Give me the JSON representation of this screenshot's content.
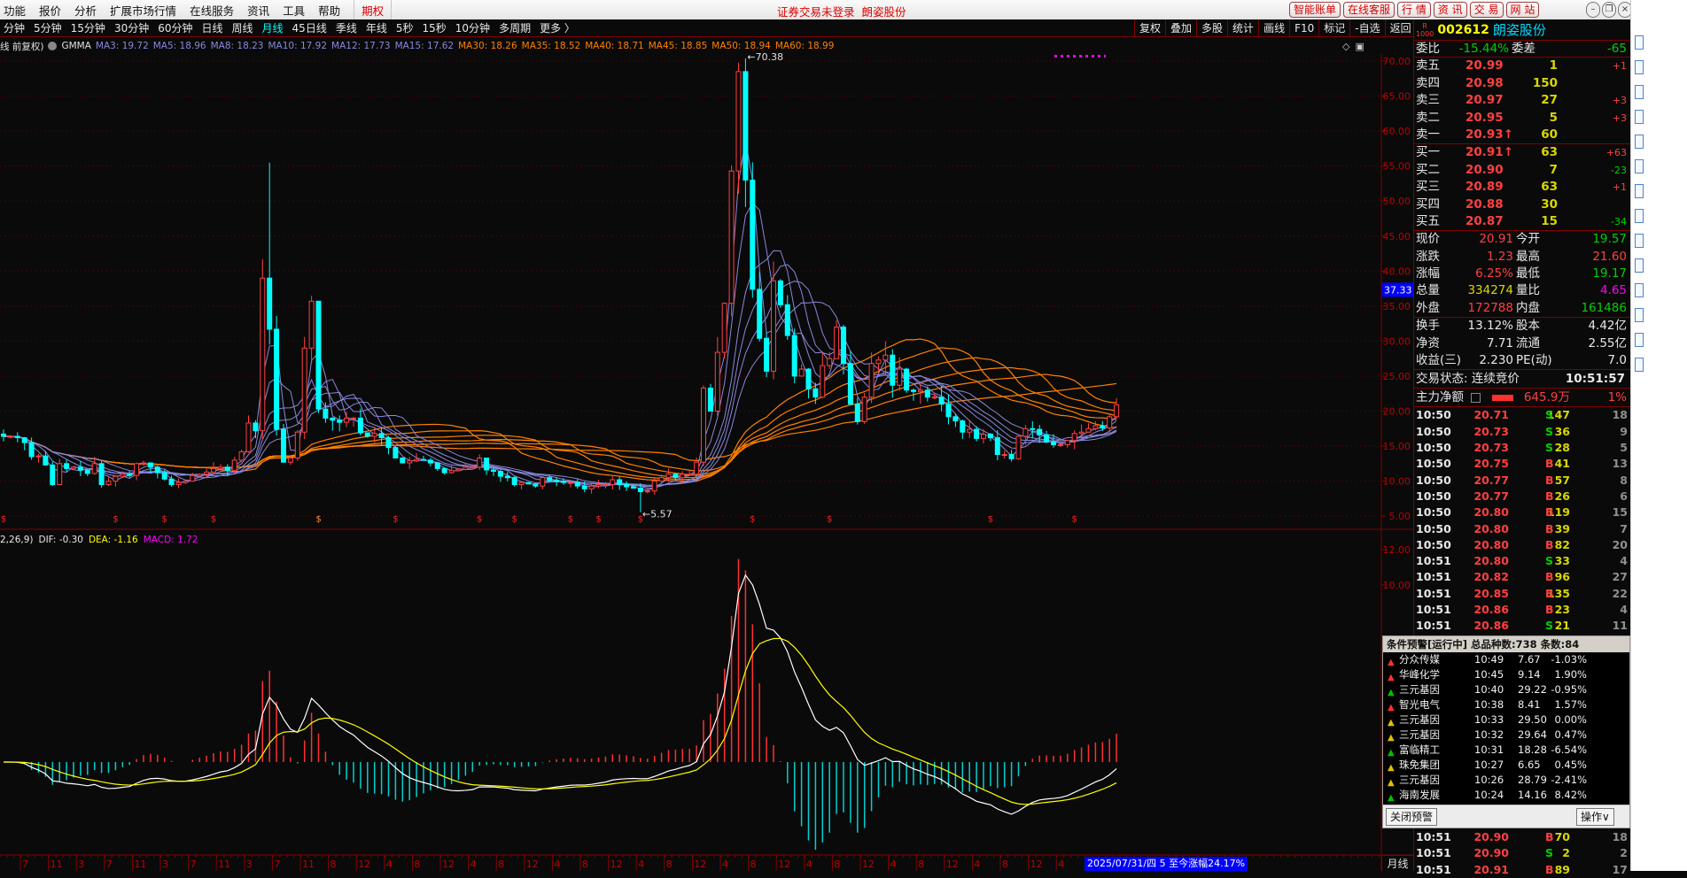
{
  "menu": [
    "功能",
    "报价",
    "分析",
    "扩展市场行情",
    "在线服务",
    "资讯",
    "工具",
    "帮助"
  ],
  "menu_option": "期权",
  "login_status": "证券交易未登录",
  "window_stock": "朗姿股份",
  "top_buttons": [
    "智能账单",
    "在线客服",
    "行 情",
    "资 讯",
    "交 易",
    "网 站"
  ],
  "window_buttons": [
    "–",
    "❐",
    "×"
  ],
  "periods": [
    "分钟",
    "5分钟",
    "15分钟",
    "30分钟",
    "60分钟",
    "日线",
    "周线",
    "月线",
    "45日线",
    "季线",
    "年线",
    "5秒",
    "15秒",
    "10分钟",
    "多周期",
    "更多 〉"
  ],
  "active_period": "月线",
  "tools": [
    "复权",
    "叠加",
    "多股",
    "统计",
    "画线",
    "F10",
    "标记",
    "-自选",
    "返回"
  ],
  "ma_legend": {
    "prefix": "线 前复权)",
    "name": "GMMA",
    "short": [
      "MA3: 19.72",
      "MA5: 18.96",
      "MA8: 18.23",
      "MA10: 17.92",
      "MA12: 17.73",
      "MA15: 17.62"
    ],
    "long": [
      "MA30: 18.26",
      "MA35: 18.52",
      "MA40: 18.71",
      "MA45: 18.85",
      "MA50: 18.94",
      "MA60: 18.99"
    ]
  },
  "macd_legend": {
    "params": "2,26,9)",
    "dif": "DIF: -0.30",
    "dea": "DEA: -1.16",
    "macd": "MACD: 1.72"
  },
  "colors": {
    "up": "#ff4040",
    "down": "#00ffff",
    "ma_short": "#8888dd",
    "ma_long": "#ff8000",
    "dif": "#ffffff",
    "dea": "#ffff00"
  },
  "chart_data": {
    "type": "candlestick",
    "period": "月线",
    "closes": [
      16.4,
      16.4,
      16.2,
      15.5,
      13.5,
      13.6,
      12.3,
      9.5,
      12.5,
      11.8,
      12,
      11.6,
      11.1,
      12.5,
      9.5,
      10,
      10.7,
      11,
      10.8,
      12.5,
      12.6,
      12,
      11.2,
      10.3,
      9.5,
      9.8,
      10,
      10.8,
      11,
      11.3,
      11.8,
      12,
      11.5,
      13,
      14.2,
      18.3,
      17.2,
      39,
      31.7,
      17.4,
      12.7,
      13.3,
      17,
      29,
      35.7,
      20.3,
      19,
      18.7,
      18.4,
      19,
      19,
      16.9,
      16.4,
      16.8,
      16.2,
      14.8,
      13.3,
      12.6,
      12.9,
      13.1,
      13,
      12.6,
      11.8,
      11.2,
      11.5,
      11.7,
      12,
      12,
      13.3,
      11.6,
      11.4,
      10.7,
      10.5,
      9.5,
      9.8,
      9.6,
      9.3,
      10.5,
      10.1,
      10,
      9.8,
      9.8,
      9.3,
      8.9,
      9.3,
      9.5,
      9.5,
      10.2,
      9.5,
      9.2,
      9,
      8.5,
      8.6,
      10,
      10.5,
      11,
      10.5,
      11,
      11,
      12.7,
      23.3,
      20,
      28.4,
      35.4,
      54.3,
      68.5,
      53,
      37.4,
      30.4,
      25.7,
      38.6,
      35.2,
      30.8,
      25,
      26,
      23.2,
      22,
      26.5,
      27.5,
      32,
      26.8,
      21,
      18.5,
      22,
      26.8,
      27.3,
      28,
      23.7,
      26,
      23,
      22.8,
      23,
      22,
      22,
      21,
      19.2,
      18.6,
      17,
      17.4,
      16.1,
      16.7,
      16.2,
      13.8,
      13.8,
      13.2,
      16.4,
      17.5,
      17.4,
      16.6,
      15.6,
      15.2,
      15.2,
      15.8,
      16.8,
      17,
      17.5,
      17.9,
      17.6,
      19.2,
      20.91
    ],
    "extremes": [
      {
        "index": 38,
        "high": 55.5
      },
      {
        "index": 106,
        "high": 70.38,
        "label": "70.38"
      },
      {
        "index": 91,
        "low": 5.57,
        "label": "5.57"
      }
    ],
    "price_axis": [
      "70.00",
      "65.00",
      "60.00",
      "55.00",
      "50.00",
      "45.00",
      "40.00",
      "35.00",
      "30.00",
      "25.00",
      "20.00",
      "15.00",
      "10.00",
      "5.00"
    ],
    "price_axis_values": [
      70,
      65,
      60,
      55,
      50,
      45,
      40,
      35,
      30,
      25,
      20,
      15,
      10,
      5
    ],
    "cursor_price": "37.33",
    "macd_axis": [
      "12.00",
      "10.00"
    ],
    "macd_axis_values": [
      12,
      10
    ],
    "signal_marks": [
      0,
      16,
      23,
      30,
      45,
      56,
      68,
      73,
      81,
      85,
      91,
      107,
      118,
      141,
      153
    ],
    "x_labels": [
      "7",
      "11",
      "3",
      "7",
      "11",
      "3",
      "7",
      "11",
      "3",
      "7",
      "11",
      "8",
      "12",
      "4",
      "8",
      "12",
      "4",
      "8",
      "12",
      "4",
      "8",
      "12",
      "4",
      "8",
      "12",
      "4",
      "8",
      "12",
      "4",
      "8",
      "12",
      "4",
      "8",
      "12",
      "4",
      "8",
      "12",
      "4"
    ]
  },
  "status_box": "2025/07/31/四 5 至今涨幅24.17%",
  "period_label": "月线",
  "panel": {
    "badge_top": "R",
    "badge_bottom": "1000",
    "code": "002612",
    "name": "朗姿股份",
    "weibi_label": "委比",
    "weibi": "-15.44%",
    "weicha_label": "委差",
    "weicha": "-65",
    "sells": [
      {
        "label": "卖五",
        "price": "20.99",
        "vol": "1",
        "chg": "+1"
      },
      {
        "label": "卖四",
        "price": "20.98",
        "vol": "150",
        "chg": ""
      },
      {
        "label": "卖三",
        "price": "20.97",
        "vol": "27",
        "chg": "+3"
      },
      {
        "label": "卖二",
        "price": "20.95",
        "vol": "5",
        "chg": "+3"
      },
      {
        "label": "卖一",
        "price": "20.93↑",
        "vol": "60",
        "chg": ""
      }
    ],
    "buys": [
      {
        "label": "买一",
        "price": "20.91↑",
        "vol": "63",
        "chg": "+63"
      },
      {
        "label": "买二",
        "price": "20.90",
        "vol": "7",
        "chg": "-23"
      },
      {
        "label": "买三",
        "price": "20.89",
        "vol": "63",
        "chg": "+1"
      },
      {
        "label": "买四",
        "price": "20.88",
        "vol": "30",
        "chg": ""
      },
      {
        "label": "买五",
        "price": "20.87",
        "vol": "15",
        "chg": "-34"
      }
    ],
    "quote": [
      {
        "l1": "现价",
        "v1": "20.91",
        "l2": "今开",
        "v2": "19.57"
      },
      {
        "l1": "涨跌",
        "v1": "1.23",
        "l2": "最高",
        "v2": "21.60"
      },
      {
        "l1": "涨幅",
        "v1": "6.25%",
        "l2": "最低",
        "v2": "19.17"
      },
      {
        "l1": "总量",
        "v1": "334274",
        "l2": "量比",
        "v2": "4.65"
      },
      {
        "l1": "外盘",
        "v1": "172788",
        "l2": "内盘",
        "v2": "161486"
      }
    ],
    "stats": [
      {
        "l1": "换手",
        "v1": "13.12%",
        "l2": "股本",
        "v2": "4.42亿"
      },
      {
        "l1": "净资",
        "v1": "7.71",
        "l2": "流通",
        "v2": "2.55亿"
      },
      {
        "l1": "收益(三)",
        "v1": "2.230",
        "l2": "PE(动)",
        "v2": "7.0"
      }
    ],
    "trade_status": "交易状态: 连续竞价",
    "trade_time": "10:51:57",
    "main_flow_label": "主力净额",
    "main_flow": "645.9万",
    "main_flow_pct": "1%",
    "ticks": [
      [
        "10:50",
        "20.71",
        "147",
        "S",
        "18"
      ],
      [
        "10:50",
        "20.73",
        "36",
        "S",
        "9"
      ],
      [
        "10:50",
        "20.73",
        "28",
        "S",
        "5"
      ],
      [
        "10:50",
        "20.75",
        "41",
        "B",
        "13"
      ],
      [
        "10:50",
        "20.77",
        "57",
        "B",
        "8"
      ],
      [
        "10:50",
        "20.77",
        "26",
        "B",
        "6"
      ],
      [
        "10:50",
        "20.80",
        "119",
        "B",
        "15"
      ],
      [
        "10:50",
        "20.80",
        "39",
        "B",
        "7"
      ],
      [
        "10:50",
        "20.80",
        "82",
        "B",
        "20"
      ],
      [
        "10:51",
        "20.80",
        "33",
        "S",
        "4"
      ],
      [
        "10:51",
        "20.82",
        "96",
        "B",
        "27"
      ],
      [
        "10:51",
        "20.85",
        "135",
        "B",
        "22"
      ],
      [
        "10:51",
        "20.86",
        "23",
        "B",
        "4"
      ],
      [
        "10:51",
        "20.86",
        "21",
        "S",
        "11"
      ]
    ],
    "ticks_below": [
      [
        "10:51",
        "20.90",
        "70",
        "B",
        "18"
      ],
      [
        "10:51",
        "20.90",
        "2",
        "S",
        "2"
      ],
      [
        "10:51",
        "20.91",
        "89",
        "B",
        "17"
      ]
    ]
  },
  "alert": {
    "title": "条件预警[运行中] 总品种数:738 条数:84",
    "rows": [
      {
        "name": "分众传媒",
        "time": "10:49",
        "price": "7.67",
        "pct": "-1.03%",
        "color": "#ff3030"
      },
      {
        "name": "华峰化学",
        "time": "10:45",
        "price": "9.14",
        "pct": "1.90%",
        "color": "#ff3030"
      },
      {
        "name": "三元基因",
        "time": "10:40",
        "price": "29.22",
        "pct": "-0.95%",
        "color": "#00c000"
      },
      {
        "name": "智光电气",
        "time": "10:38",
        "price": "8.41",
        "pct": "1.57%",
        "color": "#ff3030"
      },
      {
        "name": "三元基因",
        "time": "10:33",
        "price": "29.50",
        "pct": "0.00%",
        "color": "#e0c000"
      },
      {
        "name": "三元基因",
        "time": "10:32",
        "price": "29.64",
        "pct": "0.47%",
        "color": "#e0c000"
      },
      {
        "name": "富临精工",
        "time": "10:31",
        "price": "18.28",
        "pct": "-6.54%",
        "color": "#00c000"
      },
      {
        "name": "珠免集团",
        "time": "10:27",
        "price": "6.65",
        "pct": "0.45%",
        "color": "#e0c000"
      },
      {
        "name": "三元基因",
        "time": "10:26",
        "price": "28.79",
        "pct": "-2.41%",
        "color": "#e0c000"
      },
      {
        "name": "海南发展",
        "time": "10:24",
        "price": "14.16",
        "pct": "8.42%",
        "color": "#00c000"
      }
    ],
    "close_button": "关闭预警",
    "ops_button": "操作∨"
  }
}
